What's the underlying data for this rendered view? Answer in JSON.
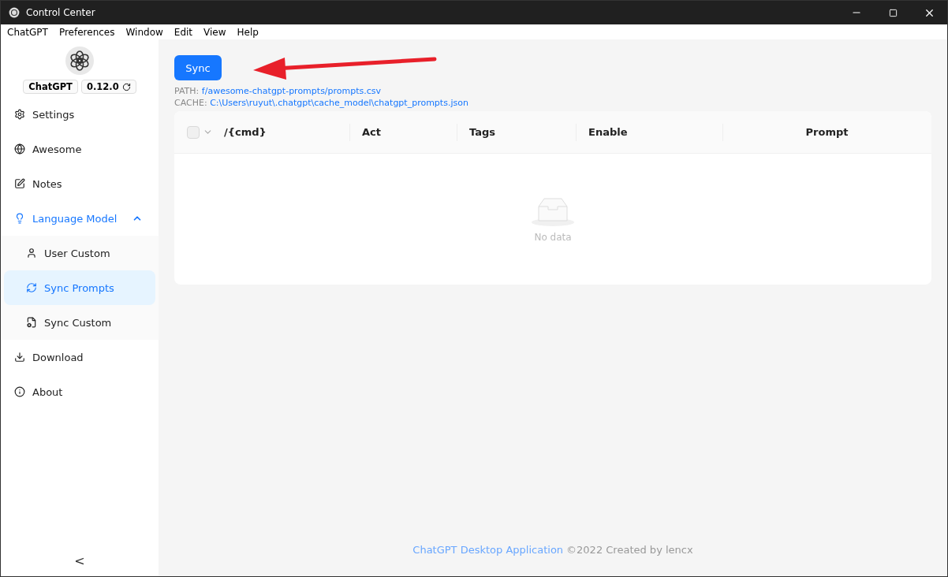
{
  "window": {
    "title": "Control Center"
  },
  "menu_bar": [
    "ChatGPT",
    "Preferences",
    "Window",
    "Edit",
    "View",
    "Help"
  ],
  "sidebar": {
    "app_name": "ChatGPT",
    "version": "0.12.0",
    "items": [
      {
        "label": "Settings",
        "selected": false
      },
      {
        "label": "Awesome",
        "selected": false
      },
      {
        "label": "Notes",
        "selected": false
      },
      {
        "label": "Language Model",
        "selected": false,
        "expanded": true,
        "children": [
          {
            "label": "User Custom",
            "selected": false
          },
          {
            "label": "Sync Prompts",
            "selected": true
          },
          {
            "label": "Sync Custom",
            "selected": false
          }
        ]
      },
      {
        "label": "Download",
        "selected": false
      },
      {
        "label": "About",
        "selected": false
      }
    ],
    "collapse": "<"
  },
  "sync_button": "Sync",
  "path": {
    "label": "PATH:",
    "value": "f/awesome-chatgpt-prompts/prompts.csv"
  },
  "cache": {
    "label": "CACHE:",
    "value": "C:\\Users\\ruyut\\.chatgpt\\cache_model\\chatgpt_prompts.json"
  },
  "table": {
    "select_all": {
      "checked": false
    },
    "columns": [
      "/{cmd}",
      "Act",
      "Tags",
      "Enable",
      "Prompt"
    ],
    "empty_text": "No data"
  },
  "footer": {
    "link": "ChatGPT Desktop Application",
    "text": "©2022 Created by lencx"
  }
}
